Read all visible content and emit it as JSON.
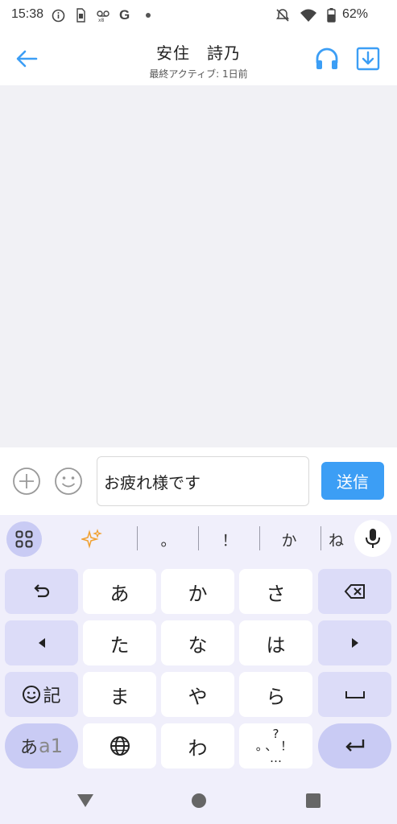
{
  "status_bar": {
    "time": "15:38",
    "battery": "62%",
    "icons": [
      "info-icon",
      "sim-icon",
      "voicemail-icon",
      "google-icon",
      "dot-icon",
      "notifications-muted-icon",
      "wifi-icon",
      "battery-icon"
    ],
    "google_letter": "G"
  },
  "header": {
    "title": "安住　詩乃",
    "subtitle": "最終アクティブ: 1日前",
    "accent_color": "#3c9ef5"
  },
  "composer": {
    "input_value": "お疲れ様です",
    "send_label": "送信"
  },
  "keyboard": {
    "suggestions": [
      "。",
      "！",
      "か",
      "ね"
    ],
    "rows": [
      [
        "undo-key",
        "あ",
        "か",
        "さ",
        "backspace-key"
      ],
      [
        "left-arrow-key",
        "た",
        "な",
        "は",
        "right-arrow-key"
      ],
      [
        "emoji-key",
        "ま",
        "や",
        "ら",
        "space-key"
      ],
      [
        "mode-key",
        "globe-key",
        "わ",
        "punct-key",
        "enter-key"
      ]
    ],
    "emoji_key_label": "記",
    "mode_key_label_main": "あ",
    "mode_key_label_sub": "a1",
    "punct_top": "?",
    "punct_mid": "。、！",
    "punct_bottom": "…"
  }
}
